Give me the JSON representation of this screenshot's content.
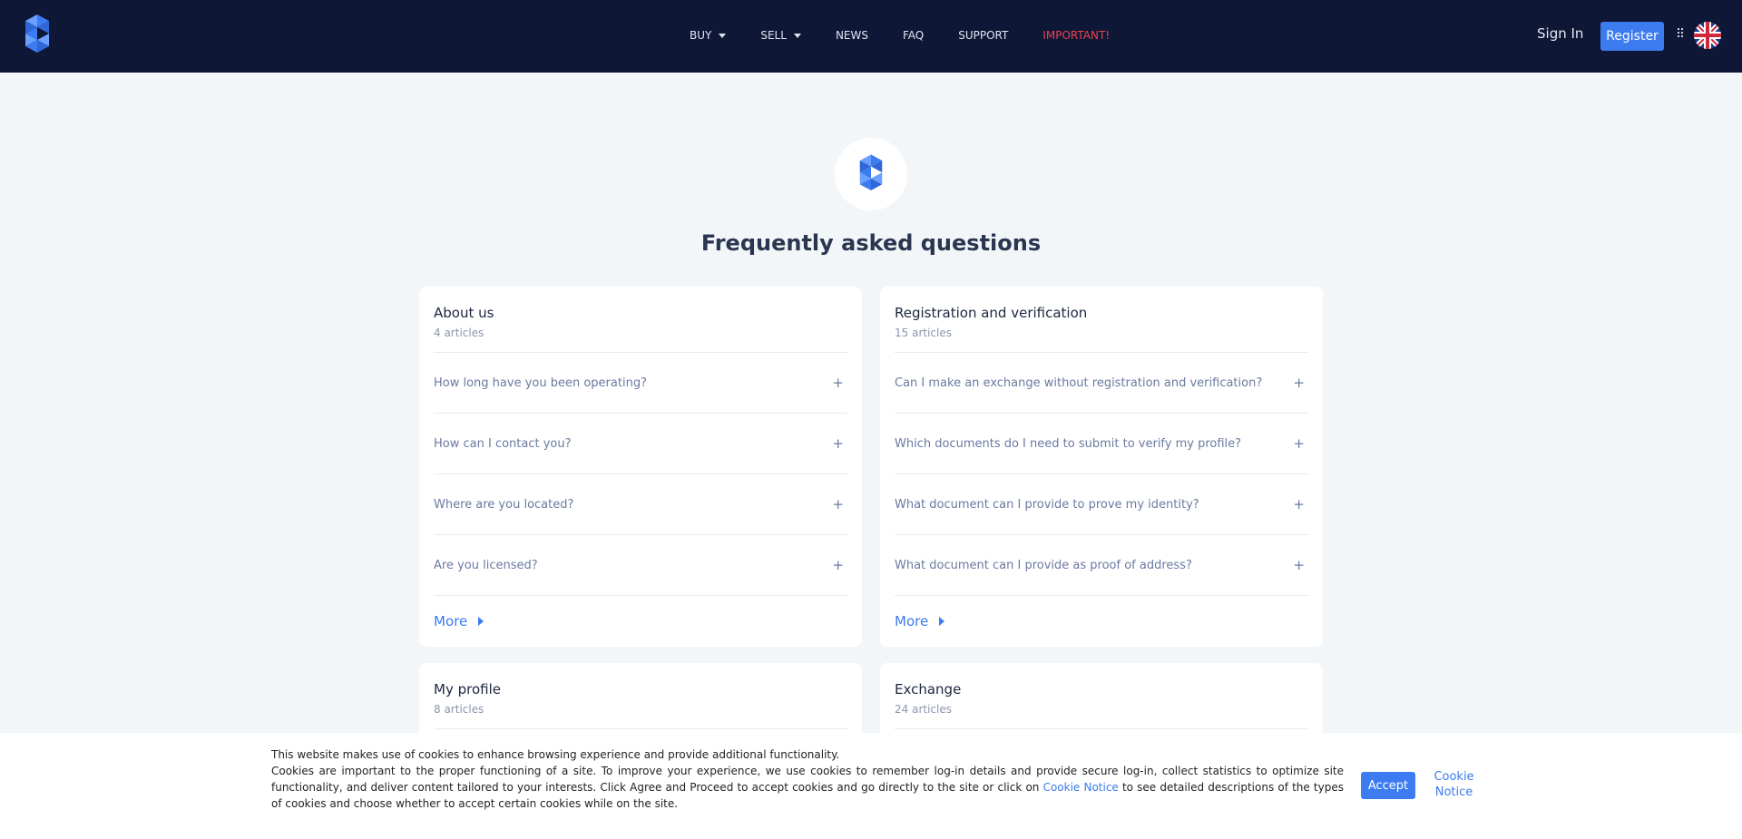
{
  "header": {
    "nav": [
      {
        "label": "BUY",
        "dropdown": true
      },
      {
        "label": "SELL",
        "dropdown": true
      },
      {
        "label": "NEWS",
        "dropdown": false
      },
      {
        "label": "FAQ",
        "dropdown": false
      },
      {
        "label": "SUPPORT",
        "dropdown": false
      },
      {
        "label": "IMPORTANT!",
        "dropdown": false
      }
    ],
    "signin_label": "Sign In",
    "register_label": "Register",
    "brand_color": "#3c7bf0",
    "important_color": "#f0414f"
  },
  "page": {
    "title": "Frequently asked questions"
  },
  "cards": [
    {
      "title": "About us",
      "count": "4 articles",
      "questions": [
        "How long have you been operating?",
        "How can I contact you?",
        "Where are you located?",
        "Are you licensed?"
      ],
      "more_label": "More"
    },
    {
      "title": "Registration and verification",
      "count": "15 articles",
      "questions": [
        "Can I make an exchange without registration and verification?",
        "Which documents do I need to submit to verify my profile?",
        "What document can I provide to prove my identity?",
        "What document can I provide as proof of address?"
      ],
      "more_label": "More"
    },
    {
      "title": "My profile",
      "count": "8 articles"
    },
    {
      "title": "Exchange",
      "count": "24 articles"
    }
  ],
  "cookie": {
    "line1": "This website makes use of cookies to enhance browsing experience and provide additional functionality.",
    "line2a": "Cookies are important to the proper functioning of a site. To improve your experience, we use cookies to remember log-in details and provide secure log-in, collect statistics to optimize site functionality, and deliver content tailored to your interests. Click Agree and Proceed to accept cookies and go directly to the site or click on ",
    "link_label": "Cookie Notice",
    "line2b": " to see detailed descriptions of the types of cookies and choose whether to accept certain cookies while on the site.",
    "accept_label": "Accept",
    "notice_label": "Cookie Notice"
  }
}
